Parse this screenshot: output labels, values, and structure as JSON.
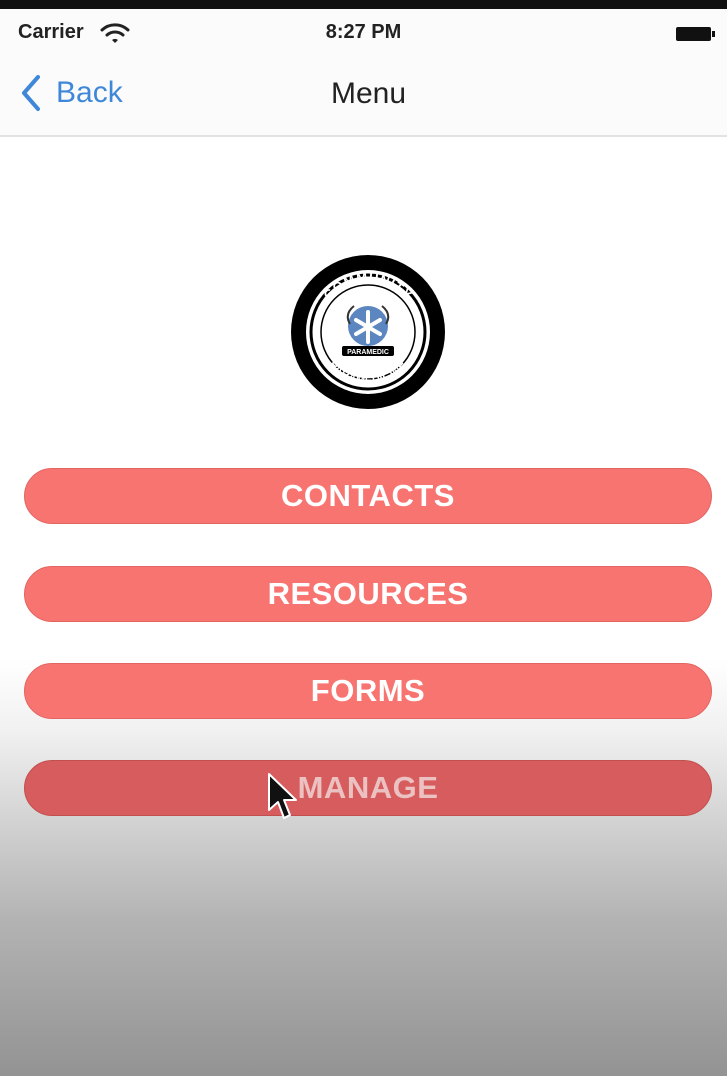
{
  "status_bar": {
    "carrier": "Carrier",
    "time": "8:27 PM",
    "wifi_icon": "wifi-icon",
    "battery_icon": "battery-icon"
  },
  "nav": {
    "back_label": "Back",
    "back_icon": "chevron-left-icon",
    "title": "Menu"
  },
  "logo": {
    "top_text": "COMMUNITY",
    "bottom_text": "PARAMEDICINE",
    "icon": "community-paramedicine-logo"
  },
  "menu": {
    "items": [
      {
        "label": "CONTACTS"
      },
      {
        "label": "RESOURCES"
      },
      {
        "label": "FORMS"
      },
      {
        "label": "MANAGE"
      }
    ]
  },
  "colors": {
    "button": "#f87471",
    "button_pressed": "#d75c5d",
    "accent": "#3f88d9"
  }
}
